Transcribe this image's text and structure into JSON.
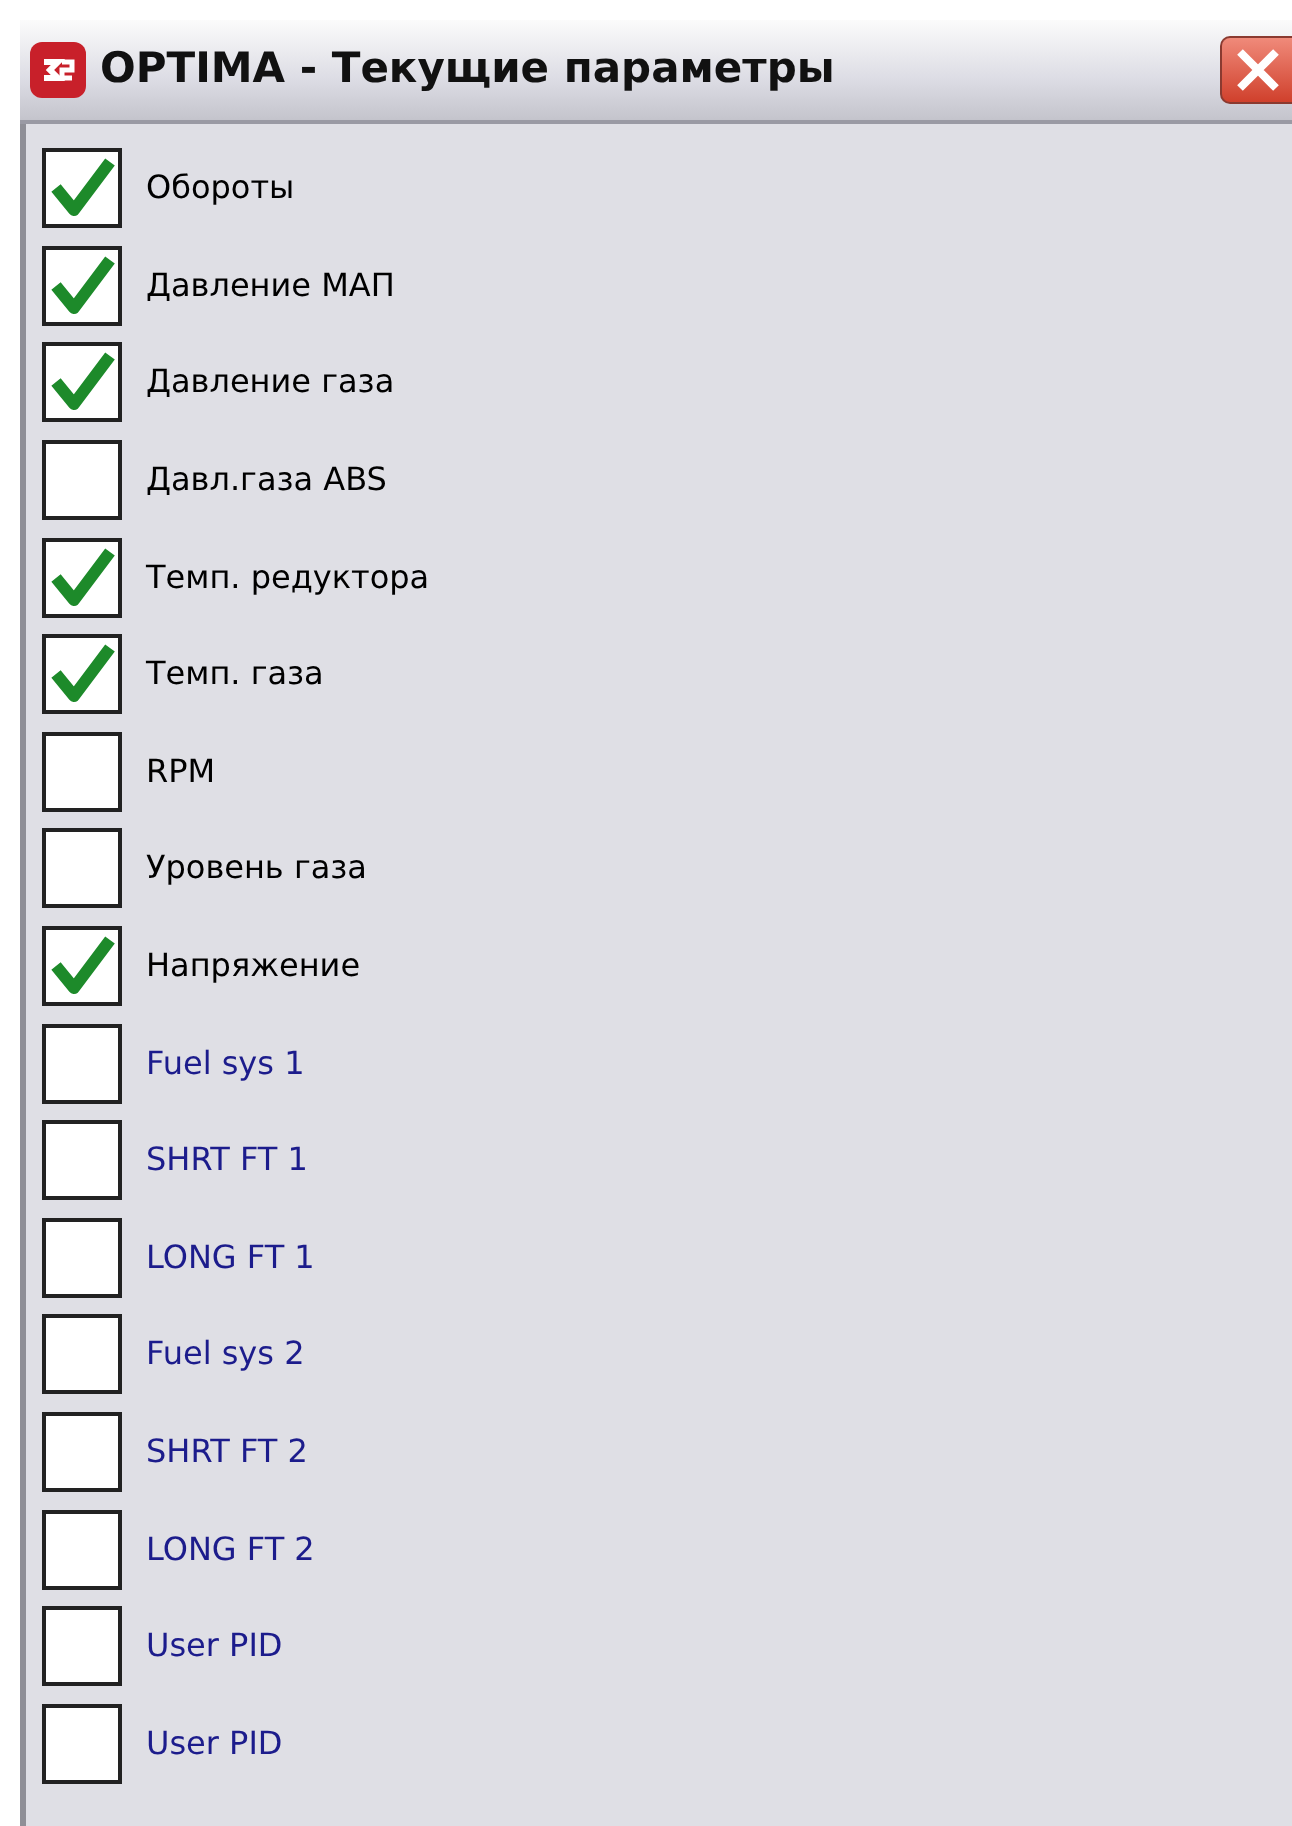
{
  "window": {
    "title": "OPTIMA - Текущие параметры"
  },
  "parameters": [
    {
      "label": "Обороты",
      "checked": true,
      "color": "#000000"
    },
    {
      "label": "Давление МАП",
      "checked": true,
      "color": "#000000"
    },
    {
      "label": "Давление газа",
      "checked": true,
      "color": "#000000"
    },
    {
      "label": "Давл.газа ABS",
      "checked": false,
      "color": "#000000"
    },
    {
      "label": "Темп. редуктора",
      "checked": true,
      "color": "#000000"
    },
    {
      "label": "Темп. газа",
      "checked": true,
      "color": "#000000"
    },
    {
      "label": "RPM",
      "checked": false,
      "color": "#000000"
    },
    {
      "label": "Уровень газа",
      "checked": false,
      "color": "#000000"
    },
    {
      "label": "Напряжение",
      "checked": true,
      "color": "#000000"
    },
    {
      "label": "Fuel sys 1",
      "checked": false,
      "color": "#1c1c8c"
    },
    {
      "label": "SHRT FT 1",
      "checked": false,
      "color": "#1c1c8c"
    },
    {
      "label": "LONG FT 1",
      "checked": false,
      "color": "#1c1c8c"
    },
    {
      "label": "Fuel sys 2",
      "checked": false,
      "color": "#1c1c8c"
    },
    {
      "label": "SHRT FT 2",
      "checked": false,
      "color": "#1c1c8c"
    },
    {
      "label": "LONG FT 2",
      "checked": false,
      "color": "#1c1c8c"
    },
    {
      "label": "User PID",
      "checked": false,
      "color": "#1c1c8c"
    },
    {
      "label": "User PID",
      "checked": false,
      "color": "#1c1c8c"
    }
  ]
}
